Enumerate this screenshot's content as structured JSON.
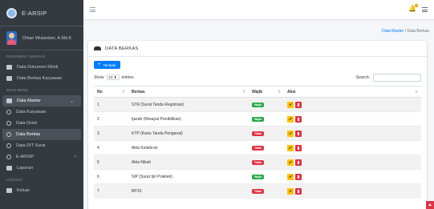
{
  "brand": {
    "title": "E-ARSIP"
  },
  "user": {
    "name": "Dhian Wulandari, A.Md.K"
  },
  "sidebar": {
    "sections": [
      {
        "header": "DOKUMEN / BERKAS",
        "items": [
          {
            "label": "Data Dokumen Klinik",
            "icon": "table-icon"
          },
          {
            "label": "Data Berkas Karyawan",
            "icon": "table-icon"
          }
        ]
      },
      {
        "header": "MAIN MENU",
        "items": [
          {
            "label": "Data Master",
            "icon": "dashboard-icon",
            "expanded": true
          },
          {
            "label": "Data Karyawan",
            "icon": "circle-icon"
          },
          {
            "label": "Data Divisi",
            "icon": "circle-icon"
          },
          {
            "label": "Data Berkas",
            "icon": "circle-icon",
            "active": true
          },
          {
            "label": "Data D/T Surat",
            "icon": "circle-icon"
          },
          {
            "label": "E-ARSIP",
            "icon": "palette-icon"
          },
          {
            "label": "Laporan",
            "icon": "table-icon"
          }
        ]
      },
      {
        "header": "LOGOUT",
        "items": [
          {
            "label": "Keluar",
            "icon": "logout-icon"
          }
        ]
      }
    ]
  },
  "breadcrumb": {
    "parent": "Data Master",
    "separator": "/",
    "current": "Data Berkas"
  },
  "card": {
    "title": "DATA BERKAS",
    "add_button": "Tambah",
    "show_label": "Show",
    "entries_value": "10",
    "entries_label": "entries",
    "search_label": "Search:"
  },
  "table": {
    "headers": [
      "No",
      "Berkas",
      "Wajib",
      "Aksi"
    ],
    "rows": [
      {
        "no": "1",
        "berkas": "STR (Surat Tanda Registrasi)",
        "wajib": "Wajib",
        "wajib_color": "#28a745"
      },
      {
        "no": "2",
        "berkas": "Ijazah (Riwayat Pendidikan)",
        "wajib": "Wajib",
        "wajib_color": "#28a745"
      },
      {
        "no": "3",
        "berkas": "KTP (Kartu Tanda Pengenal)",
        "wajib": "Tidak",
        "wajib_color": "#dc3545"
      },
      {
        "no": "4",
        "berkas": "Akta Kelahiran",
        "wajib": "Tidak",
        "wajib_color": "#dc3545"
      },
      {
        "no": "5",
        "berkas": "Akta Nikah",
        "wajib": "Tidak",
        "wajib_color": "#dc3545"
      },
      {
        "no": "6",
        "berkas": "SIP (Surat Ijin Praktek)",
        "wajib": "Wajib",
        "wajib_color": "#28a745"
      },
      {
        "no": "7",
        "berkas": "BPJS",
        "wajib": "Tidak",
        "wajib_color": "#dc3545"
      }
    ]
  },
  "colors": {
    "sidebar_bg": "#343a40",
    "primary": "#007bff",
    "success": "#28a745",
    "danger": "#dc3545",
    "warning": "#ffc107"
  }
}
